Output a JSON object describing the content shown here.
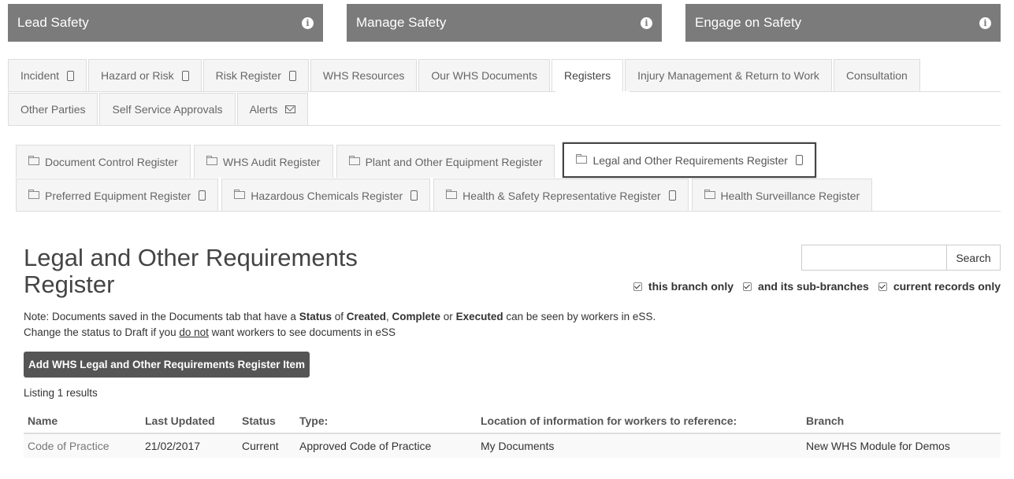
{
  "panels": [
    {
      "label": "Lead Safety"
    },
    {
      "label": "Manage Safety"
    },
    {
      "label": "Engage on Safety"
    }
  ],
  "info_glyph": "i",
  "tabs_row1": [
    {
      "label": "Incident",
      "icon": "mobile-icon"
    },
    {
      "label": "Hazard or Risk",
      "icon": "mobile-icon"
    },
    {
      "label": "Risk Register",
      "icon": "mobile-icon"
    },
    {
      "label": "WHS Resources"
    },
    {
      "label": "Our WHS Documents"
    },
    {
      "label": "Registers",
      "active": true
    },
    {
      "label": "Injury Management & Return to Work"
    },
    {
      "label": "Consultation"
    }
  ],
  "tabs_row2": [
    {
      "label": "Other Parties"
    },
    {
      "label": "Self Service Approvals"
    },
    {
      "label": "Alerts",
      "icon": "envelope-icon"
    }
  ],
  "subtabs_row1": [
    {
      "label": "Document Control Register"
    },
    {
      "label": "WHS Audit Register"
    },
    {
      "label": "Plant and Other Equipment Register"
    },
    {
      "label": "Legal and Other Requirements Register",
      "active": true,
      "icon": "mobile-icon"
    }
  ],
  "subtabs_row2": [
    {
      "label": "Preferred Equipment Register",
      "icon": "mobile-icon"
    },
    {
      "label": "Hazardous Chemicals Register",
      "icon": "mobile-icon"
    },
    {
      "label": "Health & Safety Representative Register",
      "icon": "mobile-icon"
    },
    {
      "label": "Health Surveillance Register"
    }
  ],
  "page": {
    "title_line1": "Legal and Other Requirements",
    "title_line2": "Register"
  },
  "search": {
    "placeholder": "",
    "button_label": "Search"
  },
  "filters": {
    "this_branch": "this branch only",
    "sub_branches": "and its sub-branches",
    "current_records": "current records only"
  },
  "note": {
    "prefix": "Note:  Documents saved in the Documents tab that have a ",
    "status": "Status",
    "of": " of ",
    "created": "Created",
    "comma": ", ",
    "complete": "Complete",
    "or": " or ",
    "executed": "Executed",
    "suffix": " can be seen by workers in eSS.",
    "line2_prefix": "Change the status to Draft if you ",
    "do_not": "do not",
    "line2_suffix": " want workers to see documents in eSS"
  },
  "add_button_label": "Add WHS Legal and Other Requirements Register Item",
  "listing_text": "Listing 1 results",
  "table": {
    "headers": [
      "Name",
      "Last Updated",
      "Status",
      "Type:",
      "Location of information for workers to reference:",
      "Branch"
    ],
    "rows": [
      [
        "Code of Practice",
        "21/02/2017",
        "Current",
        "Approved Code of Practice",
        "My Documents",
        "New WHS Module for Demos"
      ]
    ]
  }
}
